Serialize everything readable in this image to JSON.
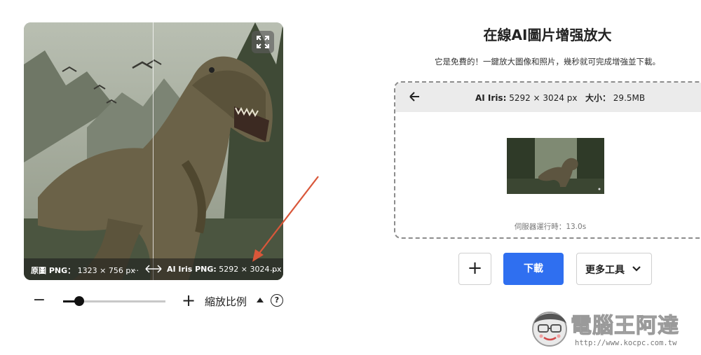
{
  "preview": {
    "original_label": "原圖 PNG：",
    "original_size": "1323 × 756 px",
    "original_more": "…",
    "ai_label": "AI Iris PNG:",
    "ai_size": "5292 × 3024 px",
    "ai_more": "…",
    "icons": {
      "expand": "expand-icon",
      "swap": "swap-arrows-icon"
    }
  },
  "zoom": {
    "minus": "−",
    "plus": "+",
    "label": "縮放比例",
    "help": "?",
    "level": 0.16
  },
  "panel": {
    "title": "在線AI圖片增强放大",
    "subtitle": "它是免費的！一鍵放大圖像和照片，幾秒就可完成增強並下載。",
    "header_model": "AI Iris:",
    "header_dims": "5292 × 3024 px",
    "header_size_label": "大小：",
    "header_size_value": "29.5MB",
    "server_label": "伺服器運行時：",
    "server_time": "13.0s"
  },
  "actions": {
    "add": "+",
    "download": "下載",
    "more_tools": "更多工具"
  },
  "watermark": {
    "title": "電腦王阿達",
    "url": "http://www.kocpc.com.tw"
  },
  "colors": {
    "accent": "#2f6ff0",
    "annotation_arrow": "#d9573a",
    "header_bg": "#ebebeb"
  }
}
